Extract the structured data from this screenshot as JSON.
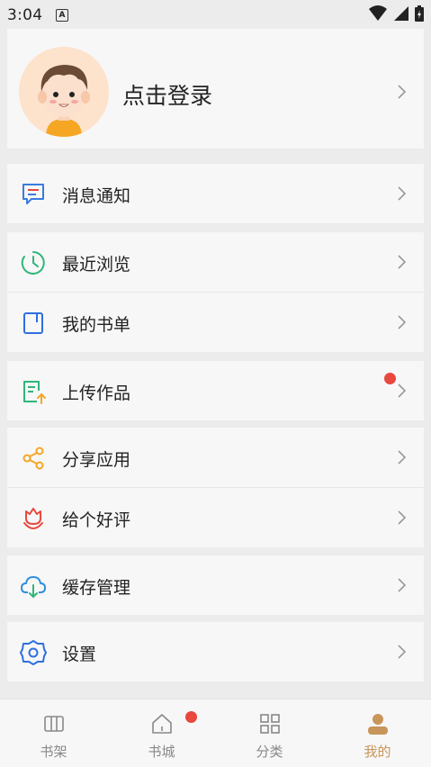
{
  "status_bar": {
    "time": "3:04",
    "notification_icon": "A",
    "icons": [
      "wifi-icon",
      "signal-icon",
      "battery-icon"
    ]
  },
  "profile": {
    "avatar": "cartoon-avatar",
    "login_label": "点击登录"
  },
  "menu": {
    "messages": {
      "label": "消息通知",
      "icon": "message-icon"
    },
    "recent": {
      "label": "最近浏览",
      "icon": "clock-icon"
    },
    "booklist": {
      "label": "我的书单",
      "icon": "bookmark-icon"
    },
    "upload": {
      "label": "上传作品",
      "icon": "upload-document-icon",
      "has_badge": true
    },
    "share": {
      "label": "分享应用",
      "icon": "share-icon"
    },
    "rate": {
      "label": "给个好评",
      "icon": "flower-icon"
    },
    "cache": {
      "label": "缓存管理",
      "icon": "cloud-download-icon"
    },
    "settings": {
      "label": "设置",
      "icon": "gear-icon"
    }
  },
  "tabbar": {
    "tabs": [
      {
        "label": "书架",
        "icon": "bookshelf-icon",
        "active": false
      },
      {
        "label": "书城",
        "icon": "home-icon",
        "active": false,
        "has_badge": true
      },
      {
        "label": "分类",
        "icon": "grid-icon",
        "active": false
      },
      {
        "label": "我的",
        "icon": "person-icon",
        "active": true
      }
    ]
  },
  "colors": {
    "accent": "#c8955a",
    "badge": "#e8483d",
    "background": "#ececec",
    "card": "#f7f7f7"
  }
}
